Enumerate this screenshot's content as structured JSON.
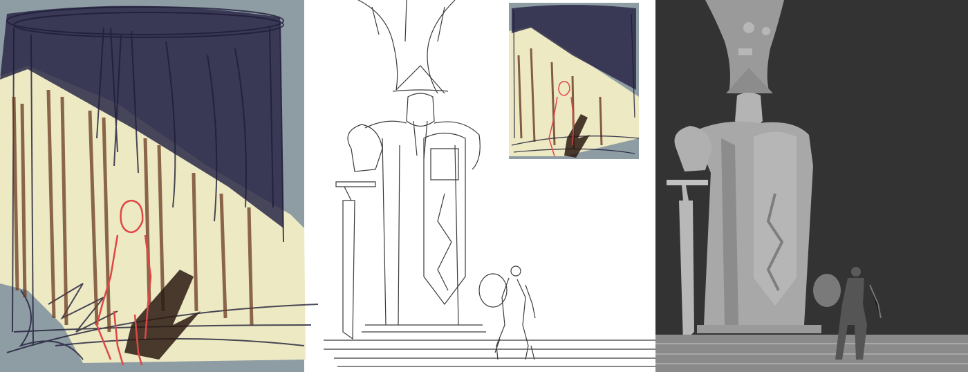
{
  "colors": {
    "thumb_grey_blue": "#8e9ca3",
    "thumb_cream": "#ece9c3",
    "thumb_navy_scribble": "#1e1c38",
    "thumb_brown": "#6a3a22",
    "thumb_red_figure": "#e04646",
    "sketch_line": "#3a3a3a",
    "value_background": "#333333",
    "value_statue_light": "#a8a8a8",
    "value_statue_mid": "#8c8c8c",
    "value_figure": "#555555"
  },
  "panels": [
    {
      "kind": "color-thumbnail-sketch"
    },
    {
      "kind": "line-sketch-with-inset-thumbnail"
    },
    {
      "kind": "grayscale-value-render"
    }
  ]
}
